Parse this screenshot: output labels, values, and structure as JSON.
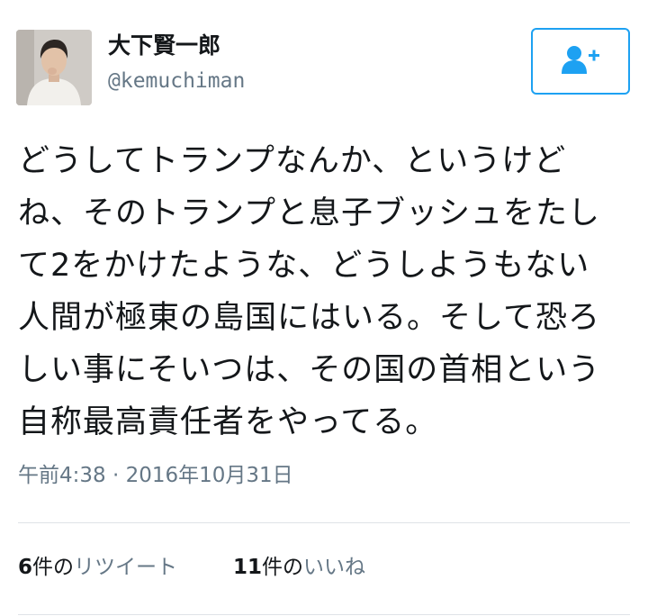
{
  "tweet": {
    "user": {
      "display_name": "大下賢一郎",
      "handle": "@kemuchiman"
    },
    "follow_icon": "add-user-icon",
    "text_lines": [
      "どうしてトランプなんか、というけど",
      "ね、そのトランプと息子ブッシュをたし",
      "て2をかけたような、どうしようもない",
      "人間が極東の島国にはいる。そして恐ろ",
      "しい事にそいつは、その国の首相という",
      "自称最高責任者をやってる。"
    ],
    "timestamp": "午前4:38 · 2016年10月31日",
    "stats": {
      "retweets": {
        "count": "6",
        "unit": "件の",
        "label": "リツイート"
      },
      "likes": {
        "count": "11",
        "unit": "件の",
        "label": "いいね"
      }
    }
  },
  "colors": {
    "accent": "#1da1f2",
    "text": "#14171a",
    "secondary": "#657786",
    "divider": "#dfe3e7"
  }
}
